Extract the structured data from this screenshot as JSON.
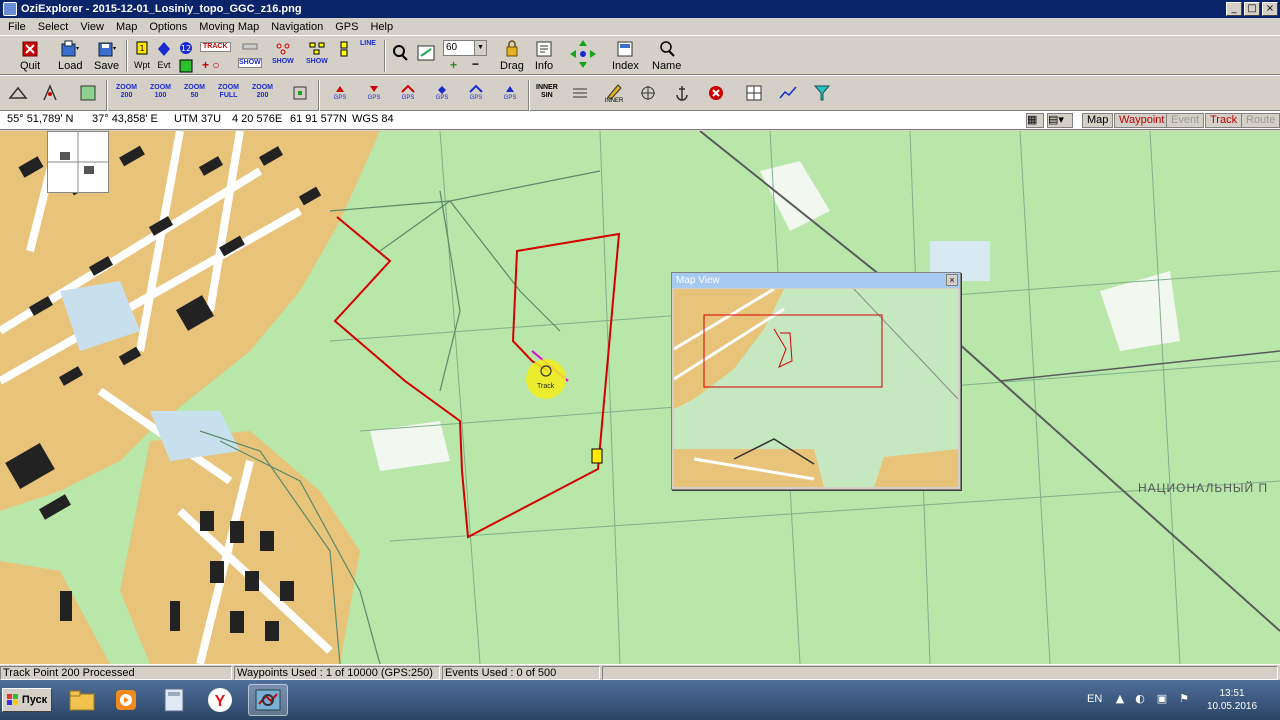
{
  "window": {
    "title": "OziExplorer - 2015-12-01_Losiniy_topo_GGC_z16.png",
    "controls": [
      "_",
      "□",
      "×"
    ]
  },
  "menu": [
    "File",
    "Select",
    "View",
    "Map",
    "Options",
    "Moving Map",
    "Navigation",
    "GPS",
    "Help"
  ],
  "toolbar1": {
    "quit": "Quit",
    "load": "Load",
    "save": "Save",
    "wpt": "Wpt",
    "evt": "Evt",
    "track": "TRACK",
    "show1": "SHOW",
    "show2": "SHOW",
    "show3": "SHOW",
    "line": "LINE",
    "zoom_value": "60",
    "drag": "Drag",
    "info": "Info",
    "index": "Index",
    "name": "Name",
    "plus": "+",
    "minus": "−"
  },
  "toolbar2": {
    "zoom_buttons": [
      {
        "top": "ZOOM",
        "bottom": "200"
      },
      {
        "top": "ZOOM",
        "bottom": "100"
      },
      {
        "top": "ZOOM",
        "bottom": "50"
      },
      {
        "top": "ZOOM",
        "bottom": "FULL"
      },
      {
        "top": "ZOOM",
        "bottom": "200"
      }
    ],
    "gps_label": "GPS",
    "inner_sin": "INNER\nSIN",
    "inner": "INNER"
  },
  "coords": {
    "lat": "55° 51,789' N",
    "lon": "37° 43,858' E",
    "utm": "UTM  37U",
    "easting": "4 20 576E",
    "northing": "61 91 577N",
    "datum": "WGS 84"
  },
  "view_tabs": {
    "map": "Map",
    "waypoint": "Waypoint",
    "event": "Event",
    "track": "Track",
    "route": "Route"
  },
  "map": {
    "region_label": "НАЦИОНАЛЬНЫЙ П",
    "track_label": "Track"
  },
  "mapview": {
    "title": "Map View",
    "close": "×"
  },
  "status": {
    "track": "Track Point 200 Processed",
    "waypoints": "Waypoints Used : 1 of 10000  (GPS:250)",
    "events": "Events Used : 0 of 500"
  },
  "taskbar": {
    "start": "Пуск",
    "lang": "EN",
    "time": "13:51",
    "date": "10.05.2016"
  },
  "colors": {
    "map_green": "#b9e6a9",
    "track_red": "#d40000",
    "building_dark": "#222222",
    "urban_tan": "#e8c37a",
    "titlebar": "#0a246a"
  }
}
